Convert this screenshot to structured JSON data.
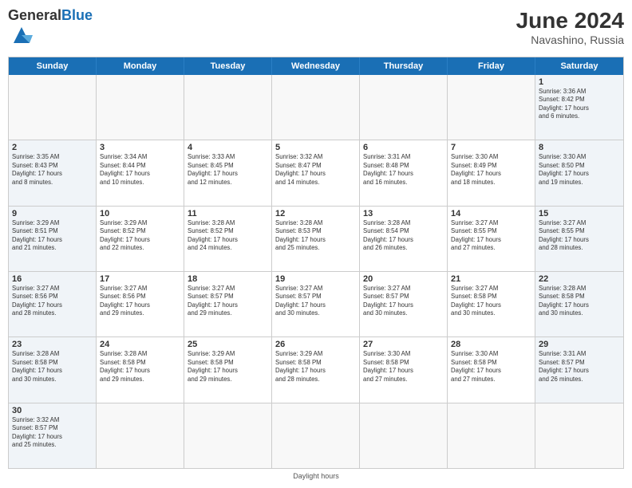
{
  "header": {
    "logo_general": "General",
    "logo_blue": "Blue",
    "month": "June 2024",
    "location": "Navashino, Russia"
  },
  "days_of_week": [
    "Sunday",
    "Monday",
    "Tuesday",
    "Wednesday",
    "Thursday",
    "Friday",
    "Saturday"
  ],
  "footer": "Daylight hours",
  "cells": [
    [
      {
        "day": "",
        "info": ""
      },
      {
        "day": "",
        "info": ""
      },
      {
        "day": "",
        "info": ""
      },
      {
        "day": "",
        "info": ""
      },
      {
        "day": "",
        "info": ""
      },
      {
        "day": "",
        "info": ""
      },
      {
        "day": "1",
        "info": "Sunrise: 3:36 AM\nSunset: 8:42 PM\nDaylight: 17 hours\nand 6 minutes."
      }
    ],
    [
      {
        "day": "2",
        "info": "Sunrise: 3:35 AM\nSunset: 8:43 PM\nDaylight: 17 hours\nand 8 minutes."
      },
      {
        "day": "3",
        "info": "Sunrise: 3:34 AM\nSunset: 8:44 PM\nDaylight: 17 hours\nand 10 minutes."
      },
      {
        "day": "4",
        "info": "Sunrise: 3:33 AM\nSunset: 8:45 PM\nDaylight: 17 hours\nand 12 minutes."
      },
      {
        "day": "5",
        "info": "Sunrise: 3:32 AM\nSunset: 8:47 PM\nDaylight: 17 hours\nand 14 minutes."
      },
      {
        "day": "6",
        "info": "Sunrise: 3:31 AM\nSunset: 8:48 PM\nDaylight: 17 hours\nand 16 minutes."
      },
      {
        "day": "7",
        "info": "Sunrise: 3:30 AM\nSunset: 8:49 PM\nDaylight: 17 hours\nand 18 minutes."
      },
      {
        "day": "8",
        "info": "Sunrise: 3:30 AM\nSunset: 8:50 PM\nDaylight: 17 hours\nand 19 minutes."
      }
    ],
    [
      {
        "day": "9",
        "info": "Sunrise: 3:29 AM\nSunset: 8:51 PM\nDaylight: 17 hours\nand 21 minutes."
      },
      {
        "day": "10",
        "info": "Sunrise: 3:29 AM\nSunset: 8:52 PM\nDaylight: 17 hours\nand 22 minutes."
      },
      {
        "day": "11",
        "info": "Sunrise: 3:28 AM\nSunset: 8:52 PM\nDaylight: 17 hours\nand 24 minutes."
      },
      {
        "day": "12",
        "info": "Sunrise: 3:28 AM\nSunset: 8:53 PM\nDaylight: 17 hours\nand 25 minutes."
      },
      {
        "day": "13",
        "info": "Sunrise: 3:28 AM\nSunset: 8:54 PM\nDaylight: 17 hours\nand 26 minutes."
      },
      {
        "day": "14",
        "info": "Sunrise: 3:27 AM\nSunset: 8:55 PM\nDaylight: 17 hours\nand 27 minutes."
      },
      {
        "day": "15",
        "info": "Sunrise: 3:27 AM\nSunset: 8:55 PM\nDaylight: 17 hours\nand 28 minutes."
      }
    ],
    [
      {
        "day": "16",
        "info": "Sunrise: 3:27 AM\nSunset: 8:56 PM\nDaylight: 17 hours\nand 28 minutes."
      },
      {
        "day": "17",
        "info": "Sunrise: 3:27 AM\nSunset: 8:56 PM\nDaylight: 17 hours\nand 29 minutes."
      },
      {
        "day": "18",
        "info": "Sunrise: 3:27 AM\nSunset: 8:57 PM\nDaylight: 17 hours\nand 29 minutes."
      },
      {
        "day": "19",
        "info": "Sunrise: 3:27 AM\nSunset: 8:57 PM\nDaylight: 17 hours\nand 30 minutes."
      },
      {
        "day": "20",
        "info": "Sunrise: 3:27 AM\nSunset: 8:57 PM\nDaylight: 17 hours\nand 30 minutes."
      },
      {
        "day": "21",
        "info": "Sunrise: 3:27 AM\nSunset: 8:58 PM\nDaylight: 17 hours\nand 30 minutes."
      },
      {
        "day": "22",
        "info": "Sunrise: 3:28 AM\nSunset: 8:58 PM\nDaylight: 17 hours\nand 30 minutes."
      }
    ],
    [
      {
        "day": "23",
        "info": "Sunrise: 3:28 AM\nSunset: 8:58 PM\nDaylight: 17 hours\nand 30 minutes."
      },
      {
        "day": "24",
        "info": "Sunrise: 3:28 AM\nSunset: 8:58 PM\nDaylight: 17 hours\nand 29 minutes."
      },
      {
        "day": "25",
        "info": "Sunrise: 3:29 AM\nSunset: 8:58 PM\nDaylight: 17 hours\nand 29 minutes."
      },
      {
        "day": "26",
        "info": "Sunrise: 3:29 AM\nSunset: 8:58 PM\nDaylight: 17 hours\nand 28 minutes."
      },
      {
        "day": "27",
        "info": "Sunrise: 3:30 AM\nSunset: 8:58 PM\nDaylight: 17 hours\nand 27 minutes."
      },
      {
        "day": "28",
        "info": "Sunrise: 3:30 AM\nSunset: 8:58 PM\nDaylight: 17 hours\nand 27 minutes."
      },
      {
        "day": "29",
        "info": "Sunrise: 3:31 AM\nSunset: 8:57 PM\nDaylight: 17 hours\nand 26 minutes."
      }
    ],
    [
      {
        "day": "30",
        "info": "Sunrise: 3:32 AM\nSunset: 8:57 PM\nDaylight: 17 hours\nand 25 minutes."
      },
      {
        "day": "",
        "info": ""
      },
      {
        "day": "",
        "info": ""
      },
      {
        "day": "",
        "info": ""
      },
      {
        "day": "",
        "info": ""
      },
      {
        "day": "",
        "info": ""
      },
      {
        "day": "",
        "info": ""
      }
    ]
  ]
}
